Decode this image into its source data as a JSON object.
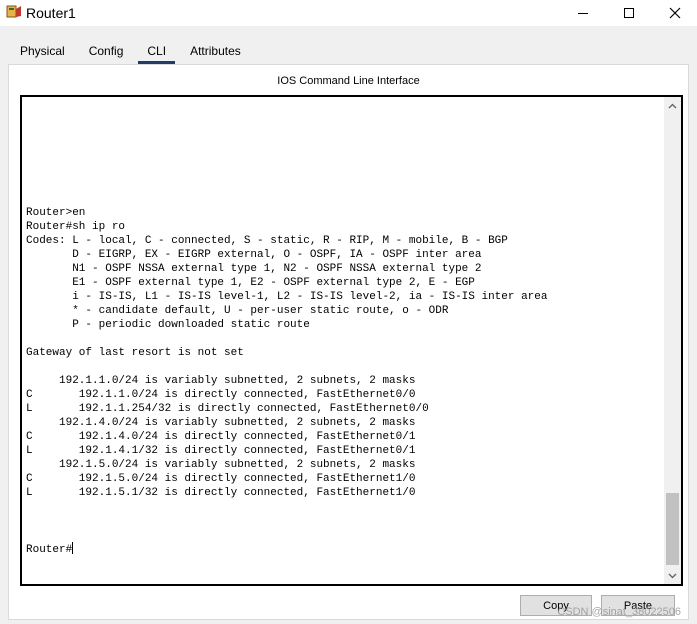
{
  "window": {
    "title": "Router1",
    "icon": "router-app-icon"
  },
  "tabs": [
    {
      "label": "Physical",
      "active": false
    },
    {
      "label": "Config",
      "active": false
    },
    {
      "label": "CLI",
      "active": true
    },
    {
      "label": "Attributes",
      "active": false
    }
  ],
  "panel": {
    "title": "IOS Command Line Interface"
  },
  "terminal": {
    "lines": [
      "Router>en",
      "Router#sh ip ro",
      "Codes: L - local, C - connected, S - static, R - RIP, M - mobile, B - BGP",
      "       D - EIGRP, EX - EIGRP external, O - OSPF, IA - OSPF inter area",
      "       N1 - OSPF NSSA external type 1, N2 - OSPF NSSA external type 2",
      "       E1 - OSPF external type 1, E2 - OSPF external type 2, E - EGP",
      "       i - IS-IS, L1 - IS-IS level-1, L2 - IS-IS level-2, ia - IS-IS inter area",
      "       * - candidate default, U - per-user static route, o - ODR",
      "       P - periodic downloaded static route",
      "",
      "Gateway of last resort is not set",
      "",
      "     192.1.1.0/24 is variably subnetted, 2 subnets, 2 masks",
      "C       192.1.1.0/24 is directly connected, FastEthernet0/0",
      "L       192.1.1.254/32 is directly connected, FastEthernet0/0",
      "     192.1.4.0/24 is variably subnetted, 2 subnets, 2 masks",
      "C       192.1.4.0/24 is directly connected, FastEthernet0/1",
      "L       192.1.4.1/32 is directly connected, FastEthernet0/1",
      "     192.1.5.0/24 is variably subnetted, 2 subnets, 2 masks",
      "C       192.1.5.0/24 is directly connected, FastEthernet1/0",
      "L       192.1.5.1/32 is directly connected, FastEthernet1/0",
      ""
    ],
    "prompt": "Router#"
  },
  "buttons": {
    "copy": "Copy",
    "paste": "Paste"
  },
  "watermark": "CSDN @sinat_38022506"
}
